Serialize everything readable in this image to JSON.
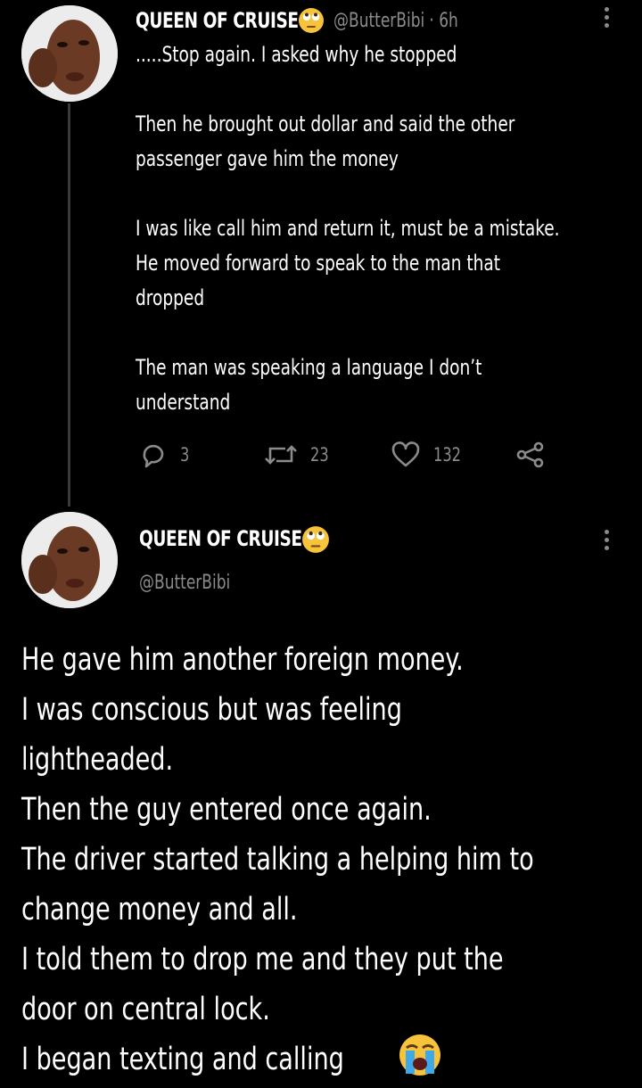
{
  "tweet1": {
    "name": "QUEEN OF CRUISE",
    "handle": "@ButterBibi",
    "time": "· 6h",
    "text": ".....Stop again. I asked why he stopped\n\nThen he brought out dollar and said the other\npassenger gave him the money\n\nI was like call him and return it, must be a mistake.\nHe moved forward to speak to the man that\ndropped\n\nThe man was speaking a language I don’t\nunderstand",
    "replies": "3",
    "retweets": "23",
    "likes": "132"
  },
  "tweet2": {
    "name": "QUEEN OF CRUISE",
    "handle": "@ButterBibi",
    "text": "He gave him another foreign money.\nI was conscious but was feeling\nlightheaded.\nThen the guy entered once again.\nThe driver started talking a helping him to\nchange money and all.\nI told them to drop me and they put the\ndoor on central lock.\nI began texting and calling"
  },
  "icons": {
    "reply": "reply-icon",
    "retweet": "retweet-icon",
    "like": "heart-icon",
    "share": "share-icon",
    "more": "more-vertical-icon",
    "name_emoji": "face-rolling-eyes-emoji",
    "end_emoji": "loudly-crying-face-emoji"
  },
  "colors": {
    "background": "#000000",
    "text": "#ffffff",
    "secondary": "#8b8b8b",
    "thread_line": "#3a3a3a"
  }
}
